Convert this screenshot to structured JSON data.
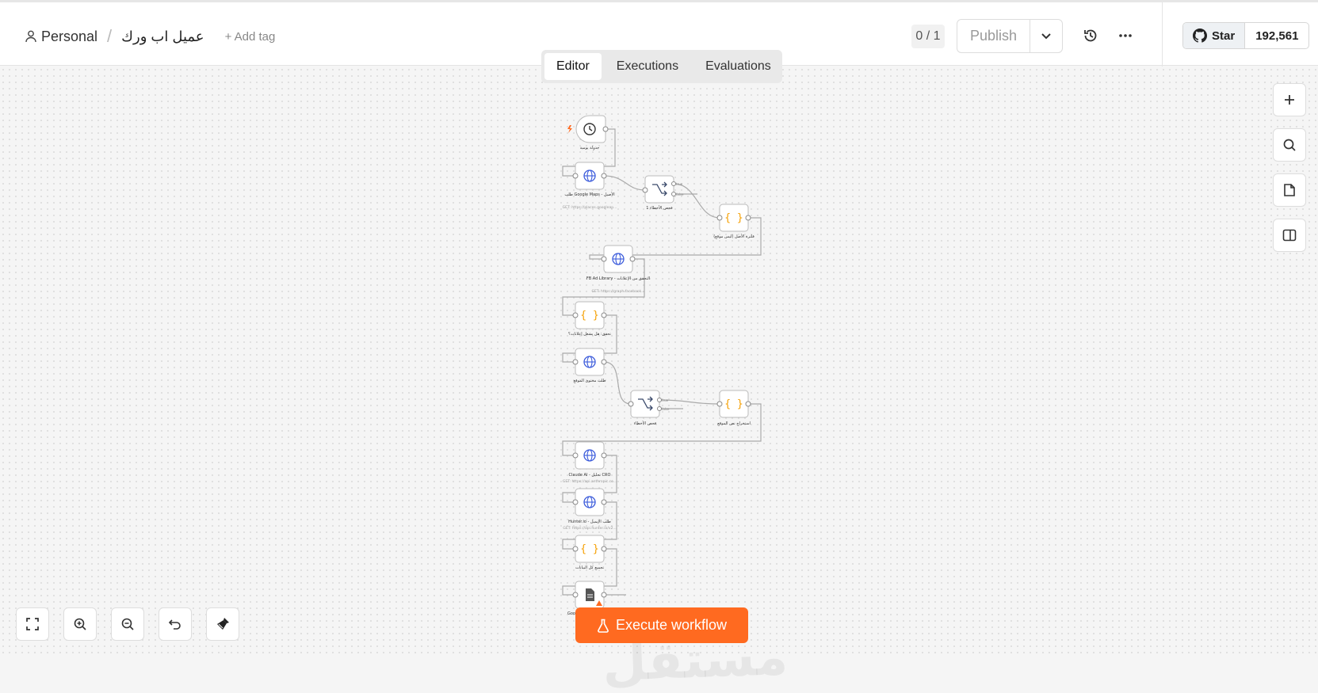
{
  "header": {
    "project": "Personal",
    "workflow_name": "عميل اب ورك",
    "add_tag": "+ Add tag",
    "counter": "0 / 1",
    "publish_label": "Publish",
    "github_star": "Star",
    "github_count": "192,561"
  },
  "tabs": [
    {
      "label": "Editor",
      "active": true
    },
    {
      "label": "Executions",
      "active": false
    },
    {
      "label": "Evaluations",
      "active": false
    }
  ],
  "execute_label": "Execute workflow",
  "watermark": "مستقل",
  "colors": {
    "accent": "#ff6a20",
    "node_blue": "#3b5bdb",
    "node_orange": "#f59f00"
  },
  "nodes": [
    {
      "id": "n1",
      "icon": "clock-icon",
      "label": "جدولة يومية"
    },
    {
      "id": "n2",
      "icon": "globe-icon",
      "label": "طلب Google Maps - الأصيل",
      "sub": "GET: https://places.googleap..."
    },
    {
      "id": "n3",
      "icon": "switch-icon",
      "label": "فحص الأخطاء 1",
      "outputs": [
        "true",
        "false"
      ]
    },
    {
      "id": "n4",
      "icon": "code-icon",
      "label": "فلترة الأصل (ليس موقع)"
    },
    {
      "id": "n5",
      "icon": "globe-icon",
      "label": "FB Ad Library - التحقق من الإعلانات",
      "sub": "GET: https://graph.facebook..."
    },
    {
      "id": "n6",
      "icon": "code-icon",
      "label": "تحقق: هل يشغل إعلانات؟"
    },
    {
      "id": "n7",
      "icon": "globe-icon",
      "label": "طلب محتوى الموقع"
    },
    {
      "id": "n8",
      "icon": "switch-icon",
      "label": "فحص الأخطاء",
      "outputs": [
        "true",
        "false"
      ]
    },
    {
      "id": "n9",
      "icon": "code-icon",
      "label": "استخراج نص الموقع"
    },
    {
      "id": "n10",
      "icon": "globe-icon",
      "label": "Claude AI - تحليل CRO",
      "sub": "GET: https://api.anthropic.co..."
    },
    {
      "id": "n11",
      "icon": "globe-icon",
      "label": "Hunter.io - طلب الإيميل",
      "sub": "GET: https://api.hunter.io/v2..."
    },
    {
      "id": "n12",
      "icon": "code-icon",
      "label": "تجميع كل البيانات"
    },
    {
      "id": "n13",
      "icon": "sheet-icon",
      "label": "Google Sheets"
    }
  ]
}
